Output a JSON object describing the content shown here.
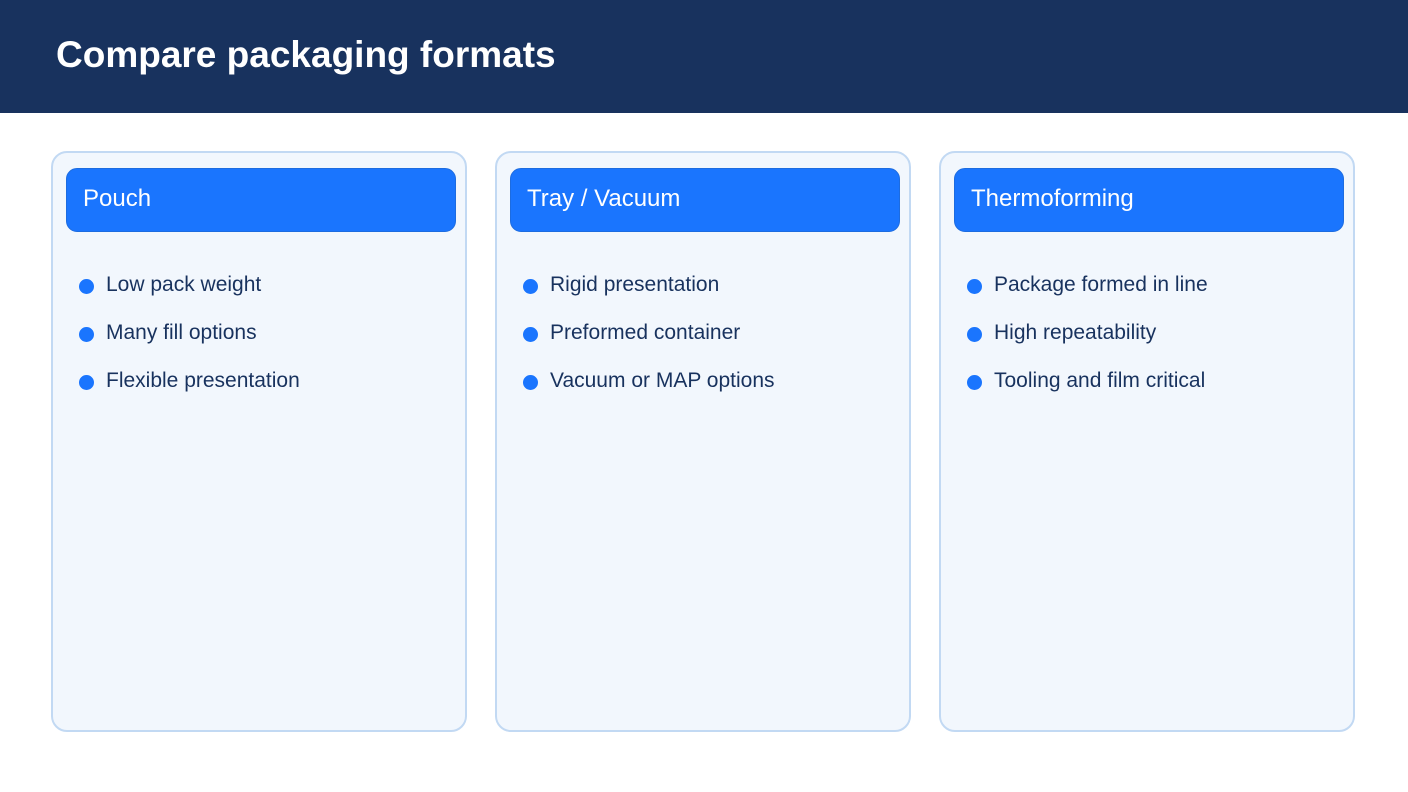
{
  "page": {
    "title": "Compare packaging formats"
  },
  "cards": [
    {
      "title": "Pouch",
      "items": [
        "Low pack weight",
        "Many fill options",
        "Flexible presentation"
      ]
    },
    {
      "title": "Tray / Vacuum",
      "items": [
        "Rigid presentation",
        "Preformed container",
        "Vacuum or MAP options"
      ]
    },
    {
      "title": "Thermoforming",
      "items": [
        "Package formed in line",
        "High repeatability",
        "Tooling and film critical"
      ]
    }
  ],
  "colors": {
    "header_bg": "#18325e",
    "accent": "#1a75fe",
    "card_bg": "#f2f7fd",
    "card_border": "#c2d9f3",
    "text": "#18325e"
  }
}
